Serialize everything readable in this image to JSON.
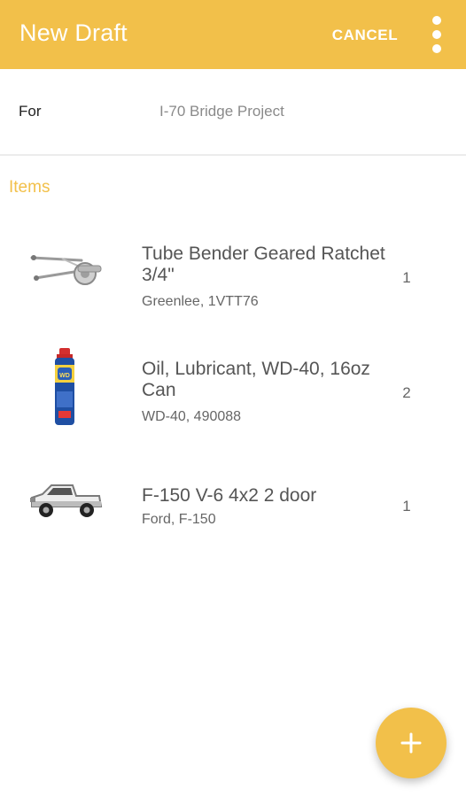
{
  "appbar": {
    "title": "New Draft",
    "cancel_label": "CANCEL",
    "overflow_icon": "more-vert-icon",
    "color": "#f2c04a"
  },
  "for_row": {
    "label": "For",
    "value": "I-70 Bridge Project"
  },
  "items_section": {
    "header": "Items",
    "items": [
      {
        "title_line1": "Tube Bender Geared Ratchet",
        "title_line2": "3/4\"",
        "subtitle": "Greenlee, 1VTT76",
        "quantity": "1",
        "thumbnail": "tube-bender-image"
      },
      {
        "title_line1": "Oil, Lubricant, WD-40, 16oz",
        "title_line2": "Can",
        "subtitle": "WD-40, 490088",
        "quantity": "2",
        "thumbnail": "wd40-can-image"
      },
      {
        "title_line1": "F-150 V-6 4x2 2 door",
        "title_line2": "",
        "subtitle": "Ford, F-150",
        "quantity": "1",
        "thumbnail": "pickup-truck-image"
      }
    ]
  },
  "fab": {
    "icon": "plus-icon"
  }
}
